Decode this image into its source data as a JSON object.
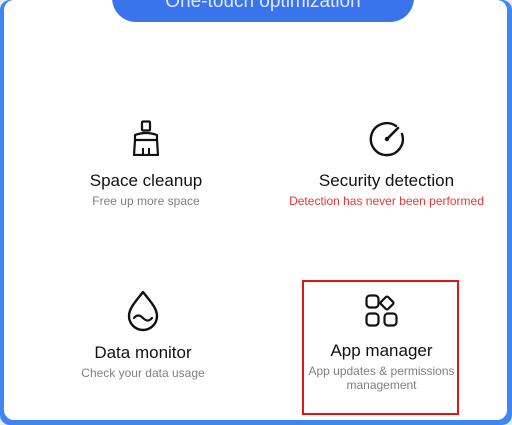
{
  "header": {
    "title": "One-touch optimization"
  },
  "tiles": [
    {
      "title": "Space cleanup",
      "subtitle": "Free up more space",
      "icon": "broom-icon"
    },
    {
      "title": "Security detection",
      "subtitle": "Detection has never been performed",
      "icon": "gauge-icon",
      "subtitle_color": "#e53935"
    },
    {
      "title": "Data monitor",
      "subtitle": "Check your data usage",
      "icon": "water-drop-icon"
    },
    {
      "title": "App manager",
      "subtitle_line1": "App updates & permissions",
      "subtitle_line2": "management",
      "icon": "apps-grid-icon"
    }
  ],
  "colors": {
    "accent": "#3f86f2",
    "header_pill": "#3a74ec",
    "highlight": "#e01616",
    "warning": "#e53935"
  }
}
